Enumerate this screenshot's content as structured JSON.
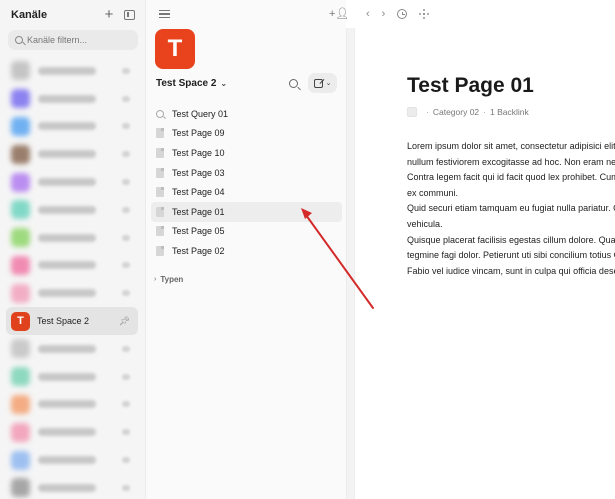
{
  "sidebar": {
    "title": "Kanäle",
    "search_placeholder": "Kanäle filtern...",
    "active_channel": {
      "name": "Test Space 2",
      "initial": "T"
    },
    "channel_colors": [
      "#bdbdbd",
      "#7a6ff0",
      "#5aa6f2",
      "#8b6a55",
      "#b07cf0",
      "#6fd4bf",
      "#8fd66a",
      "#f07aa6",
      "#f2a2bd",
      "#e0421d",
      "#c3c3c3",
      "#7dd4b6",
      "#f3a070",
      "#f29ab6",
      "#8fb7f0",
      "#9a9a9a"
    ]
  },
  "space": {
    "logo_initial": "T",
    "title": "Test Space 2",
    "pages": [
      {
        "label": "Test Query 01",
        "kind": "query"
      },
      {
        "label": "Test Page 09",
        "kind": "page"
      },
      {
        "label": "Test Page 10",
        "kind": "page"
      },
      {
        "label": "Test Page 03",
        "kind": "page"
      },
      {
        "label": "Test Page 04",
        "kind": "page"
      },
      {
        "label": "Test Page 01",
        "kind": "page",
        "selected": true
      },
      {
        "label": "Test Page 05",
        "kind": "page"
      },
      {
        "label": "Test Page 02",
        "kind": "page"
      }
    ],
    "types_label": "Typen"
  },
  "document": {
    "title": "Test Page 01",
    "category": "Category 02",
    "backlinks": "1 Backlink",
    "paragraph_lines": [
      "Lorem ipsum dolor sit amet, consectetur adipisici elit, sed eiusmod tempor incidunt",
      "nullum festiviorem excogitasse ad hoc. Non eram nescius, Brute, cum, quae summis",
      "Contra legem facit qui id facit quod lex prohibet. Cum sociis natoque penatibus et magnis dis parturient",
      "ex communi.",
      "Quid securi etiam tamquam eu fugiat nulla pariatur. Quisque ut dolor gravida, placerat libero vel, euismod",
      "vehicula.",
      "Quisque placerat facilisis egestas cillum dolore. Quae vero auctorem tractata ab fiducia dicuntur.",
      "tegmine fagi dolor. Petierunt uti sibi concilium totius Galliae in diem certam indicere.",
      "Fabio vel iudice vincam, sunt in culpa qui officia deserunt mollit anim id est laborum."
    ]
  },
  "annotation": {
    "arrow_color": "#d42a2a"
  }
}
